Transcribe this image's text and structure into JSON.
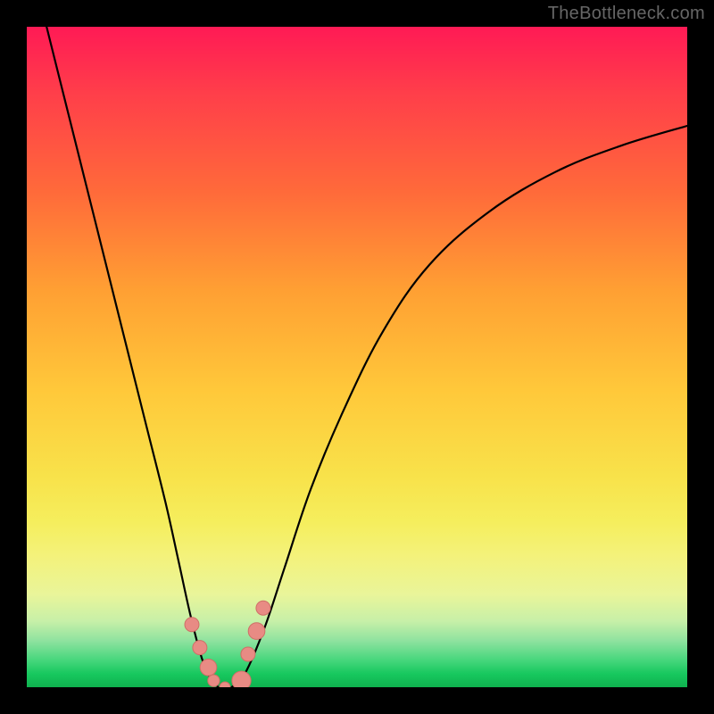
{
  "watermark": "TheBottleneck.com",
  "chart_data": {
    "type": "line",
    "title": "",
    "xlabel": "",
    "ylabel": "",
    "xlim": [
      0,
      100
    ],
    "ylim": [
      0,
      100
    ],
    "series": [
      {
        "name": "bottleneck-curve",
        "x": [
          3,
          6,
          9,
          12,
          15,
          18,
          21,
          23,
          25,
          27,
          29,
          30,
          31,
          33,
          36,
          39,
          43,
          48,
          54,
          61,
          70,
          80,
          90,
          100
        ],
        "values": [
          100,
          88,
          76,
          64,
          52,
          40,
          28,
          19,
          10,
          3,
          0,
          0,
          0,
          2,
          9,
          18,
          30,
          42,
          54,
          64,
          72,
          78,
          82,
          85
        ]
      }
    ],
    "markers": {
      "name": "highlight-markers",
      "x": [
        25.0,
        26.2,
        27.5,
        28.3,
        30.0,
        32.5,
        33.5,
        34.8,
        35.8
      ],
      "values": [
        9.5,
        6.0,
        3.0,
        1.0,
        0.0,
        1.0,
        5.0,
        8.5,
        12.0
      ],
      "r": [
        1.2,
        1.2,
        1.4,
        1.0,
        0.9,
        1.6,
        1.2,
        1.4,
        1.2
      ]
    },
    "background_gradient": [
      {
        "pos": 0,
        "color": "#ff1a55"
      },
      {
        "pos": 10,
        "color": "#ff3e4a"
      },
      {
        "pos": 25,
        "color": "#ff6a3a"
      },
      {
        "pos": 40,
        "color": "#ffa033"
      },
      {
        "pos": 55,
        "color": "#ffc83a"
      },
      {
        "pos": 68,
        "color": "#f8e24a"
      },
      {
        "pos": 75,
        "color": "#f5ee5d"
      },
      {
        "pos": 80,
        "color": "#f4f27a"
      },
      {
        "pos": 86,
        "color": "#e9f59a"
      },
      {
        "pos": 90,
        "color": "#c7f0a8"
      },
      {
        "pos": 93,
        "color": "#8ee29f"
      },
      {
        "pos": 96,
        "color": "#44d67b"
      },
      {
        "pos": 98,
        "color": "#17c85e"
      },
      {
        "pos": 100,
        "color": "#0fb14f"
      }
    ]
  }
}
